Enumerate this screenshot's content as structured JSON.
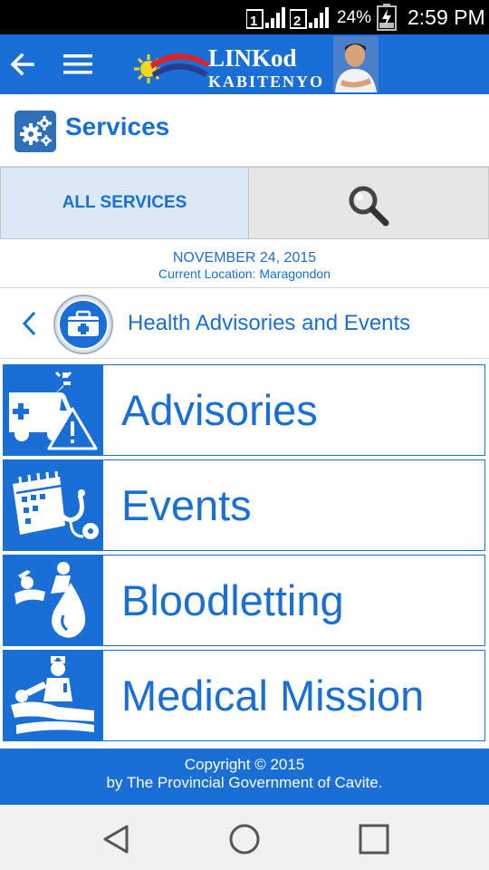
{
  "status_bar": {
    "signal_1_label": "1",
    "signal_2_label": "2",
    "battery_percent": "24%",
    "time": "2:59 PM"
  },
  "app_bar": {
    "logo_text_line1": "LINKod",
    "logo_text_line2": "KABITENYO",
    "back_icon": "arrow-left-icon",
    "menu_icon": "hamburger-menu-icon"
  },
  "section": {
    "title": "Services",
    "icon": "gears-icon"
  },
  "tabs": {
    "all_services_label": "ALL SERVICES",
    "search_icon": "search-icon"
  },
  "info": {
    "date": "NOVEMBER 24, 2015",
    "location": "Current Location: Maragondon"
  },
  "category": {
    "title": "Health Advisories and Events",
    "icon": "medical-kit-icon"
  },
  "menu_items": [
    {
      "label": "Advisories",
      "icon": "ambulance-warning-icon"
    },
    {
      "label": "Events",
      "icon": "calendar-stethoscope-icon"
    },
    {
      "label": "Bloodletting",
      "icon": "blood-donation-icon"
    },
    {
      "label": "Medical Mission",
      "icon": "medical-mission-icon"
    }
  ],
  "footer": {
    "line1": "Copyright © 2015",
    "line2": "by The Provincial Government of Cavite."
  },
  "nav_bar": {
    "back_icon": "nav-back-icon",
    "home_icon": "nav-home-icon",
    "recents_icon": "nav-recents-icon"
  },
  "colors": {
    "primary": "#1a6fd6",
    "tab_active_bg": "#dbe8f5",
    "tab_inactive_bg": "#e6e6e6"
  }
}
